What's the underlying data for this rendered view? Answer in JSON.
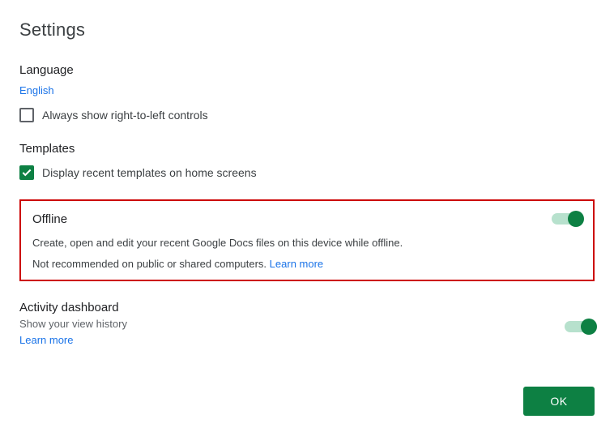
{
  "page_title": "Settings",
  "language": {
    "heading": "Language",
    "value": "English",
    "checkbox_label": "Always show right-to-left controls",
    "checkbox_checked": false
  },
  "templates": {
    "heading": "Templates",
    "checkbox_label": "Display recent templates on home screens",
    "checkbox_checked": true
  },
  "offline": {
    "heading": "Offline",
    "description": "Create, open and edit your recent Google Docs files on this device while offline.",
    "warning": "Not recommended on public or shared computers.",
    "learn_more": "Learn more",
    "toggle_on": true
  },
  "activity": {
    "heading": "Activity dashboard",
    "description": "Show your view history",
    "learn_more": "Learn more",
    "toggle_on": true
  },
  "ok_button": "OK"
}
